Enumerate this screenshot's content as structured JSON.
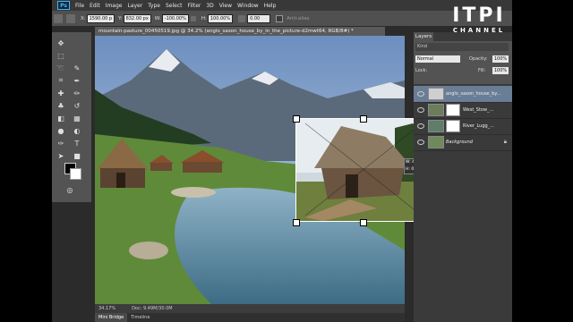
{
  "app": {
    "logo": "Ps"
  },
  "menu": [
    "File",
    "Edit",
    "Image",
    "Layer",
    "Type",
    "Select",
    "Filter",
    "3D",
    "View",
    "Window",
    "Help"
  ],
  "options": {
    "x_label": "X:",
    "x_value": "1590.00 p",
    "y_label": "Y:",
    "y_value": "832.00 px",
    "w_label": "W:",
    "w_value": "-100.00%",
    "h_label": "H:",
    "h_value": "100.00%",
    "angle_value": "0.00",
    "antialias_label": "Anti-alias"
  },
  "document": {
    "tab_title": "mountain-pasture_00450519.jpg @ 34.2% (anglo_saxon_house_by_in_the_picture-d2mwt64, RGB/8#) *",
    "transform_readout": {
      "w": "W: 4.625 in",
      "h": "H: 0.444 in"
    }
  },
  "status": {
    "zoom": "34.17%",
    "doc": "Doc: 9.49M/30.0M"
  },
  "bottom_tabs": [
    "Mini Bridge",
    "Timeline"
  ],
  "layers_panel": {
    "tab": "Layers",
    "kind": "Kind",
    "blend_mode": "Normal",
    "opacity_label": "Opacity:",
    "opacity": "100%",
    "lock_label": "Lock:",
    "fill_label": "Fill:",
    "fill": "100%",
    "layers": [
      {
        "name": "anglo_saxon_house_by...",
        "selected": true
      },
      {
        "name": "West_Stow_...",
        "selected": false
      },
      {
        "name": "River_Lugg_...",
        "selected": false
      },
      {
        "name": "Background",
        "selected": false
      }
    ]
  },
  "watermark": {
    "line1": "ITPI",
    "line2": "CHANNEL"
  }
}
